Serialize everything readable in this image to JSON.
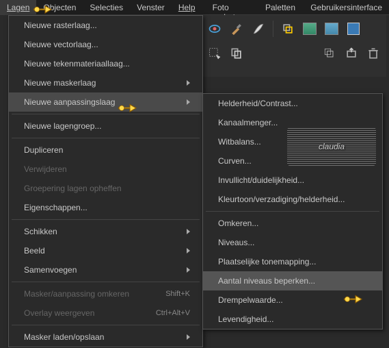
{
  "menubar": {
    "lagen": "Lagen",
    "objecten": "Objecten",
    "selecties": "Selecties",
    "venster": "Venster",
    "help": "Help",
    "foto": "Foto verbeteren",
    "paletten": "Paletten",
    "ui": "Gebruikersinterface"
  },
  "dropdown": {
    "nieuwe_rasterlaag": "Nieuwe rasterlaag...",
    "nieuwe_vectorlaag": "Nieuwe vectorlaag...",
    "nieuwe_tekenmateriaallaag": "Nieuwe tekenmateriaallaag...",
    "nieuwe_maskerlaag": "Nieuwe maskerlaag",
    "nieuwe_aanpassingslaag": "Nieuwe aanpassingslaag",
    "nieuwe_lagengroep": "Nieuwe lagengroep...",
    "dupliceren": "Dupliceren",
    "verwijderen": "Verwijderen",
    "groepering_opheffen": "Groepering lagen opheffen",
    "eigenschappen": "Eigenschappen...",
    "schikken": "Schikken",
    "beeld": "Beeld",
    "samenvoegen": "Samenvoegen",
    "masker_aanpassing_omkeren": "Masker/aanpassing omkeren",
    "overlay_weergeven": "Overlay weergeven",
    "masker_laden_opslaan": "Masker laden/opslaan",
    "shortcut_shiftk": "Shift+K",
    "shortcut_ctrlaltv": "Ctrl+Alt+V"
  },
  "submenu": {
    "helderheid_contrast": "Helderheid/Contrast...",
    "kanaalmenger": "Kanaalmenger...",
    "witbalans": "Witbalans...",
    "curven": "Curven...",
    "invullicht": "Invullicht/duidelijkheid...",
    "kleurtoon": "Kleurtoon/verzadiging/helderheid...",
    "omkeren": "Omkeren...",
    "niveaus": "Niveaus...",
    "plaatselijke_tonemapping": "Plaatselijke tonemapping...",
    "aantal_niveaus_beperken": "Aantal niveaus beperken...",
    "drempelwaarde": "Drempelwaarde...",
    "levendigheid": "Levendigheid..."
  },
  "watermark": {
    "text": "claudia"
  }
}
